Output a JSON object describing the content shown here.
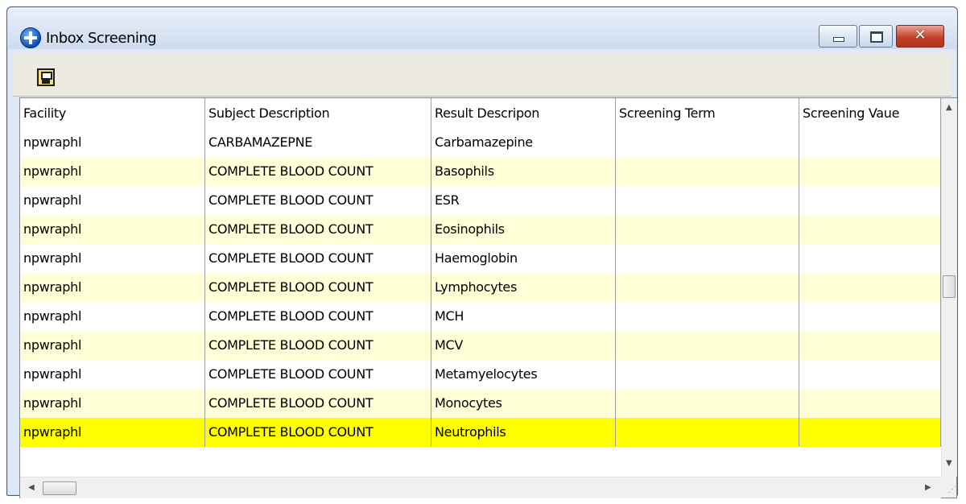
{
  "window": {
    "title": "Inbox Screening",
    "controls": {
      "minimize": "–",
      "maximize": "□",
      "close": "✕"
    }
  },
  "toolbar": {
    "save_icon": "save-disk-icon"
  },
  "table": {
    "columns": [
      "Facility",
      "Subject Description",
      "Result Descripon",
      "Screening Term",
      "Screening Vaue"
    ],
    "rows": [
      [
        "npwraphl",
        "CARBAMAZEPNE",
        "Carbamazepine",
        "",
        ""
      ],
      [
        "npwraphl",
        "COMPLETE BLOOD COUNT",
        "Basophils",
        "",
        ""
      ],
      [
        "npwraphl",
        "COMPLETE BLOOD COUNT",
        "ESR",
        "",
        ""
      ],
      [
        "npwraphl",
        "COMPLETE BLOOD COUNT",
        "Eosinophils",
        "",
        ""
      ],
      [
        "npwraphl",
        "COMPLETE BLOOD COUNT",
        "Haemoglobin",
        "",
        ""
      ],
      [
        "npwraphl",
        "COMPLETE BLOOD COUNT",
        "Lymphocytes",
        "",
        ""
      ],
      [
        "npwraphl",
        "COMPLETE BLOOD COUNT",
        "MCH",
        "",
        ""
      ],
      [
        "npwraphl",
        "COMPLETE BLOOD COUNT",
        "MCV",
        "",
        ""
      ],
      [
        "npwraphl",
        "COMPLETE BLOOD COUNT",
        "Metamyelocytes",
        "",
        ""
      ],
      [
        "npwraphl",
        "COMPLETE BLOOD COUNT",
        "Monocytes",
        "",
        ""
      ],
      [
        "npwraphl",
        "COMPLETE BLOOD COUNT",
        "Neutrophils",
        "",
        ""
      ]
    ],
    "selected_row": 10
  },
  "colors": {
    "alt_row": "#ffffd7",
    "selected_row": "#ffff00"
  }
}
